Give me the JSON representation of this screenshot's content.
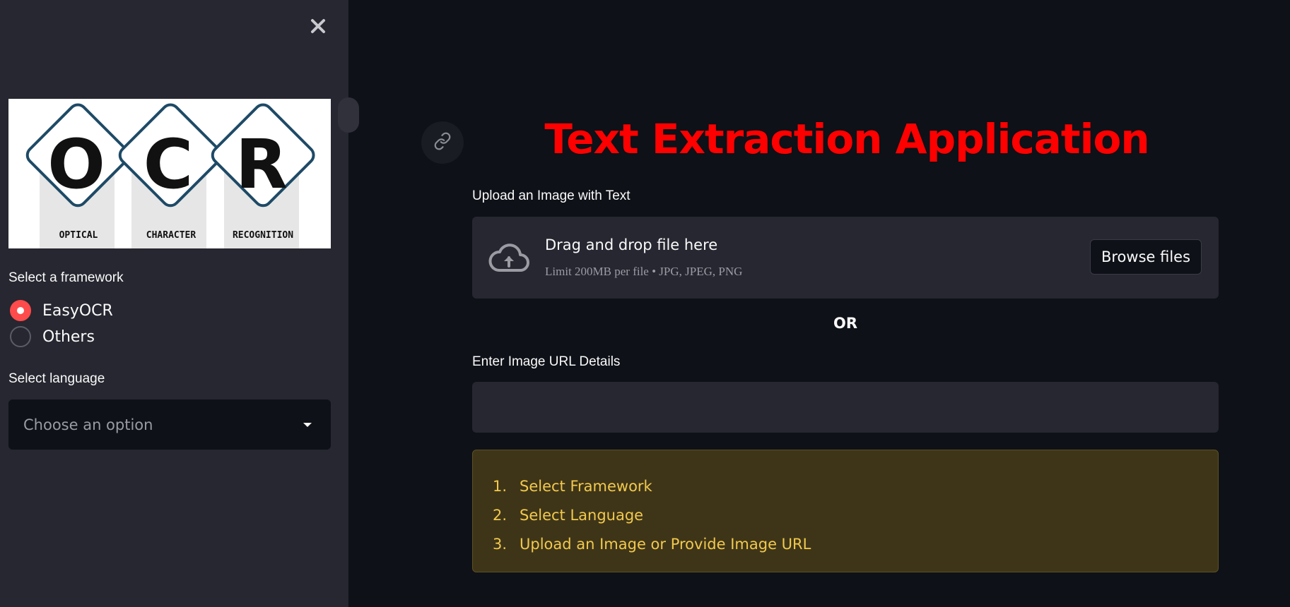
{
  "sidebar": {
    "close_icon": "close-icon",
    "logo": {
      "letters": [
        "O",
        "C",
        "R"
      ],
      "captions": [
        "OPTICAL",
        "CHARACTER",
        "RECOGNITION"
      ]
    },
    "framework_label": "Select a framework",
    "framework_options": [
      {
        "label": "EasyOCR",
        "selected": true
      },
      {
        "label": "Others",
        "selected": false
      }
    ],
    "language_label": "Select language",
    "language_select": {
      "placeholder": "Choose an option"
    }
  },
  "main": {
    "link_icon": "link-icon",
    "title": "Text Extraction Application",
    "upload_label": "Upload an Image with Text",
    "uploader": {
      "icon": "cloud-upload-icon",
      "drag_text": "Drag and drop file here",
      "limit_text": "Limit 200MB per file • JPG, JPEG, PNG",
      "browse_label": "Browse files"
    },
    "or_text": "OR",
    "url_label": "Enter Image URL Details",
    "url_value": "",
    "instructions": [
      {
        "num": "1.",
        "text": "Select Framework"
      },
      {
        "num": "2.",
        "text": "Select Language"
      },
      {
        "num": "3.",
        "text": "Upload an Image or Provide Image URL"
      }
    ]
  },
  "colors": {
    "background": "#0e1117",
    "sidebar": "#262730",
    "title": "#ff0000",
    "accent": "#ff4b4b",
    "warning_bg": "#3e3519",
    "warning_text": "#f2c94c"
  }
}
